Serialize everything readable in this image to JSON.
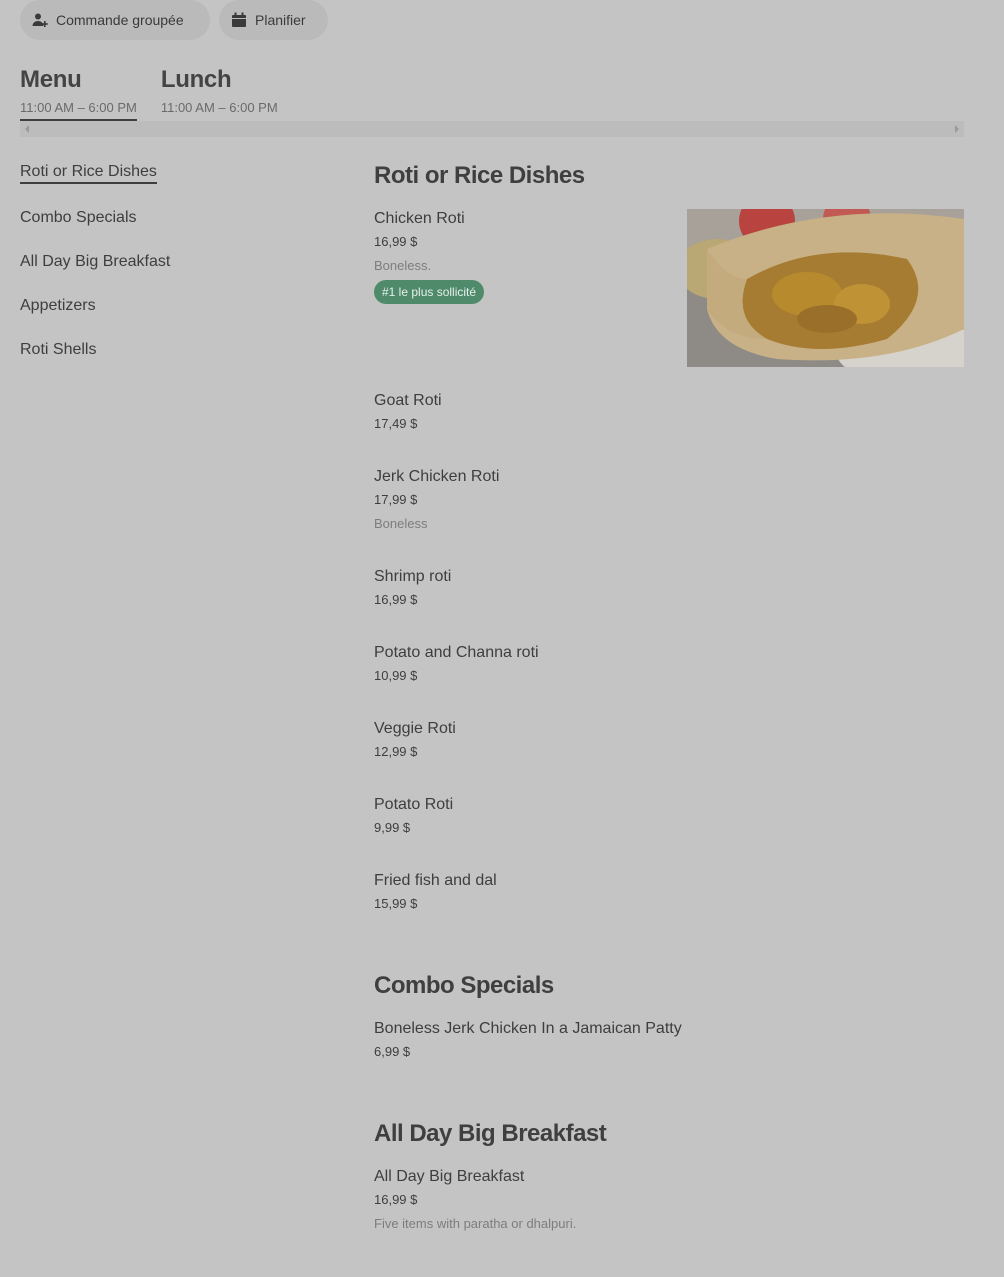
{
  "actions": {
    "group_order": "Commande groupée",
    "schedule": "Planifier"
  },
  "menus": [
    {
      "title": "Menu",
      "hours": "11:00 AM – 6:00 PM",
      "active": true
    },
    {
      "title": "Lunch",
      "hours": "11:00 AM – 6:00 PM",
      "active": false
    }
  ],
  "categories": [
    "Roti or Rice Dishes",
    "Combo Specials",
    "All Day Big Breakfast",
    "Appetizers",
    "Roti Shells"
  ],
  "sections": [
    {
      "title": "Roti or Rice Dishes",
      "items": [
        {
          "name": "Chicken Roti",
          "price": "16,99 $",
          "desc": "Boneless.",
          "badge": "#1 le plus sollicité",
          "photo": "roti-wrap-photo"
        },
        {
          "name": "Goat Roti",
          "price": "17,49 $"
        },
        {
          "name": "Jerk Chicken Roti",
          "price": "17,99 $",
          "desc": "Boneless"
        },
        {
          "name": "Shrimp roti",
          "price": "16,99 $"
        },
        {
          "name": "Potato and Channa roti",
          "price": "10,99 $"
        },
        {
          "name": "Veggie Roti",
          "price": "12,99 $"
        },
        {
          "name": "Potato Roti",
          "price": "9,99 $"
        },
        {
          "name": "Fried fish and dal",
          "price": "15,99 $"
        }
      ]
    },
    {
      "title": "Combo Specials",
      "items": [
        {
          "name": "Boneless Jerk Chicken In a Jamaican Patty",
          "price": "6,99 $"
        }
      ]
    },
    {
      "title": "All Day Big Breakfast",
      "items": [
        {
          "name": "All Day Big Breakfast",
          "price": "16,99 $",
          "desc": "Five items with paratha or dhalpuri."
        }
      ]
    }
  ],
  "colors": {
    "background": "#c4c4c4",
    "badge": "#4f8b6b",
    "text": "#3e3e3e",
    "muted": "#7d7d7d"
  }
}
